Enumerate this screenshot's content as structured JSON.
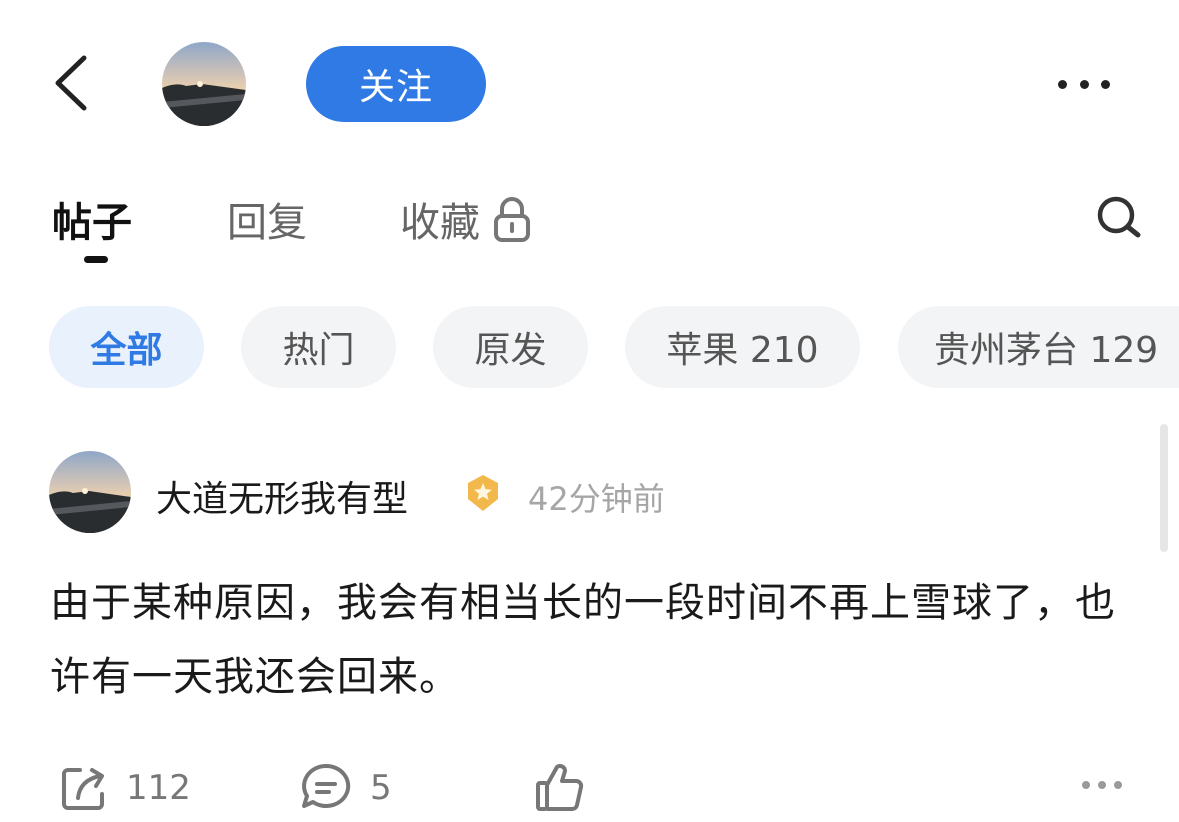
{
  "header": {
    "follow_label": "关注",
    "icons": {
      "back": "chevron-left-icon",
      "more": "more-horizontal-icon"
    }
  },
  "tabs": [
    {
      "label": "帖子",
      "active": true
    },
    {
      "label": "回复",
      "active": false
    },
    {
      "label": "收藏",
      "active": false,
      "icon": "lock-icon"
    }
  ],
  "search_icon": "search-icon",
  "filters": [
    {
      "label": "全部",
      "active": true
    },
    {
      "label": "热门"
    },
    {
      "label": "原发"
    },
    {
      "label": "苹果 210"
    },
    {
      "label": "贵州茅台 129"
    }
  ],
  "post": {
    "author": "大道无形我有型",
    "badge_icon": "verified-star-badge-icon",
    "time": "42分钟前",
    "text": "由于某种原因，我会有相当长的一段时间不再上雪球了，也许有一天我还会回来。",
    "actions": {
      "share_count": "112",
      "comment_count": "5"
    }
  },
  "colors": {
    "accent": "#2f7ae5",
    "chip_bg": "#f3f4f5",
    "chip_active_bg": "#e8f1fc",
    "muted_text": "#a6a6a6",
    "badge": "#f2b84b"
  }
}
